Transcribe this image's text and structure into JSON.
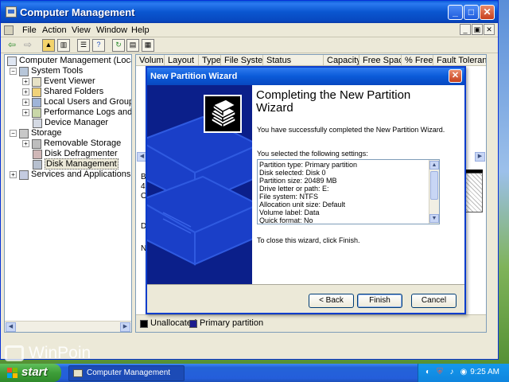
{
  "window": {
    "title": "Computer Management",
    "minimize_glyph": "_",
    "maximize_glyph": "□",
    "close_glyph": "✕"
  },
  "menubar": {
    "items": [
      "File",
      "Action",
      "View",
      "Window",
      "Help"
    ],
    "child_controls": [
      "_",
      "▣",
      "✕"
    ]
  },
  "toolbar": {
    "tools": [
      "back-arrow-icon",
      "forward-arrow-icon",
      "up-folder-icon",
      "show-tree-icon",
      "properties-icon",
      "help-icon",
      "refresh-icon",
      "export-icon",
      "help-topics-icon"
    ]
  },
  "tree": {
    "items": [
      {
        "label": "Computer Management (Local)",
        "icon": "computer-icon",
        "level": 0,
        "expander": ""
      },
      {
        "label": "System Tools",
        "icon": "tools-icon",
        "level": 1,
        "expander": "−"
      },
      {
        "label": "Event Viewer",
        "icon": "event-viewer-icon",
        "level": 2,
        "expander": "+"
      },
      {
        "label": "Shared Folders",
        "icon": "shared-folders-icon",
        "level": 2,
        "expander": "+"
      },
      {
        "label": "Local Users and Groups",
        "icon": "users-icon",
        "level": 2,
        "expander": "+"
      },
      {
        "label": "Performance Logs and Alerts",
        "icon": "perf-logs-icon",
        "level": 2,
        "expander": "+"
      },
      {
        "label": "Device Manager",
        "icon": "device-manager-icon",
        "level": 2,
        "expander": ""
      },
      {
        "label": "Storage",
        "icon": "storage-icon",
        "level": 1,
        "expander": "−"
      },
      {
        "label": "Removable Storage",
        "icon": "removable-storage-icon",
        "level": 2,
        "expander": "+"
      },
      {
        "label": "Disk Defragmenter",
        "icon": "defrag-icon",
        "level": 2,
        "expander": ""
      },
      {
        "label": "Disk Management",
        "icon": "disk-management-icon",
        "level": 2,
        "expander": "",
        "selected": true
      },
      {
        "label": "Services and Applications",
        "icon": "services-icon",
        "level": 1,
        "expander": "+"
      }
    ]
  },
  "volume_list": {
    "columns": [
      "Volume",
      "Layout",
      "Type",
      "File System",
      "Status",
      "Capacity",
      "Free Space",
      "% Free",
      "Fault Tolerance"
    ]
  },
  "disk_view": {
    "fragments": [
      "B",
      "4",
      "O",
      "D",
      "N"
    ]
  },
  "legend": {
    "items": [
      {
        "label": "Unallocated",
        "color": "#000000"
      },
      {
        "label": "Primary partition",
        "color": "#1c1c8c"
      }
    ]
  },
  "wizard": {
    "title": "New Partition Wizard",
    "heading": "Completing the New Partition Wizard",
    "success_text": "You have successfully completed the New Partition Wizard.",
    "settings_intro": "You selected the following settings:",
    "settings": [
      "Partition type: Primary partition",
      "Disk selected: Disk 0",
      "Partition size: 20489 MB",
      "Drive letter or path: E:",
      "File system: NTFS",
      "Allocation unit size: Default",
      "Volume label: Data",
      "Quick format: No"
    ],
    "finish_hint": "To close this wizard, click Finish.",
    "back_label": "< Back",
    "finish_label": "Finish",
    "cancel_label": "Cancel",
    "close_glyph": "✕",
    "side_color": "#0b1f8a"
  },
  "watermark": {
    "text": "WinPoin"
  },
  "taskbar": {
    "start_label": "start",
    "task_label": "Computer Management",
    "clock": "9:25 AM",
    "tray_icons": [
      "network-icon",
      "security-alert-icon",
      "volume-icon",
      "tray-app-icon"
    ]
  }
}
